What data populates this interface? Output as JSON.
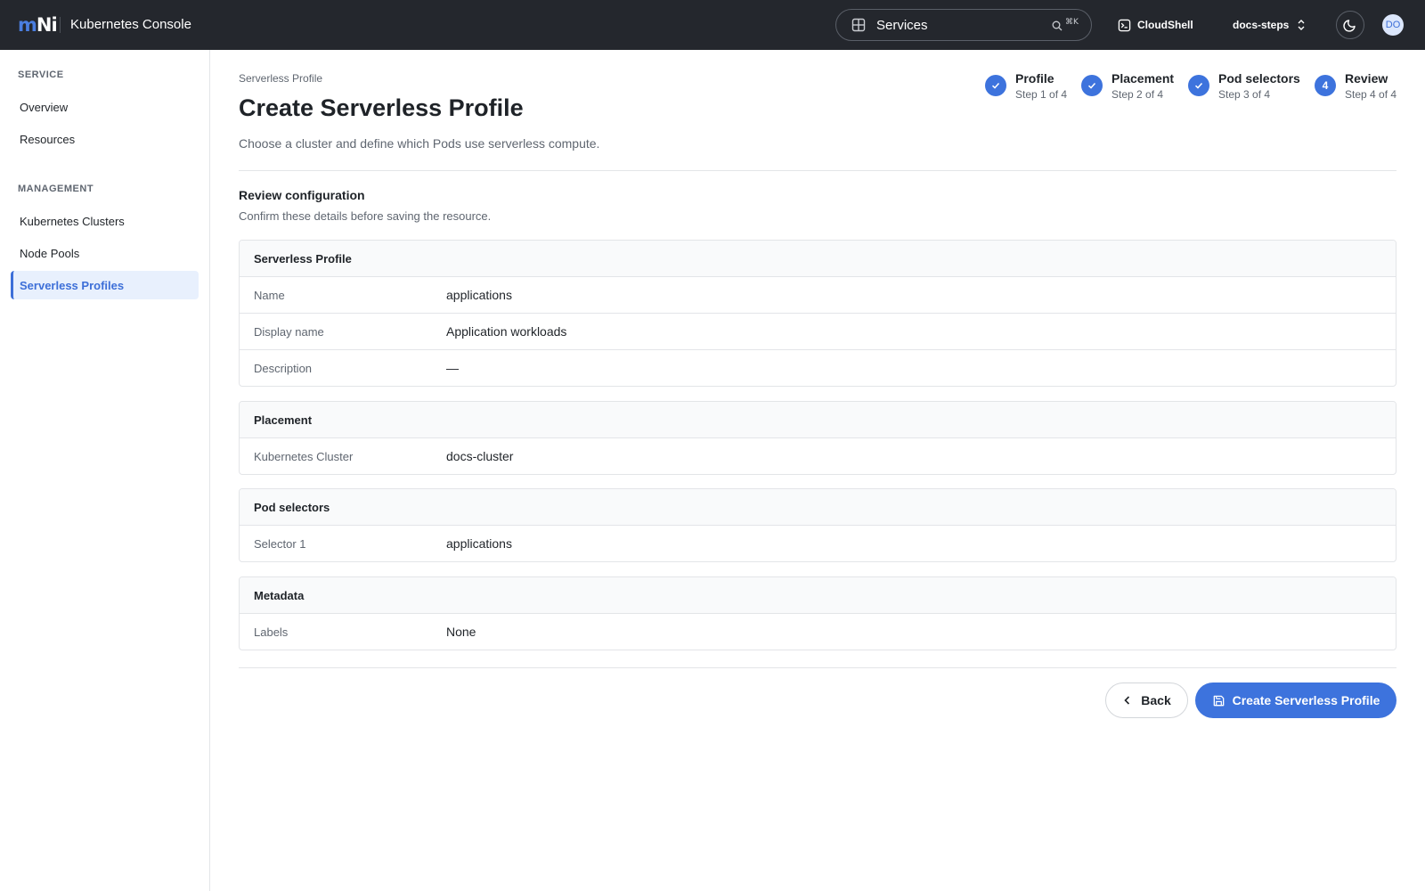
{
  "topbar": {
    "logo_m": "m",
    "logo_ni": "Ni",
    "app_title": "Kubernetes Console",
    "search_value": "Services",
    "search_shortcut": "⌘K",
    "cloudshell_label": "CloudShell",
    "project_label": "docs-steps",
    "avatar_initials": "DO"
  },
  "sidebar": {
    "sections": [
      {
        "title": "SERVICE",
        "items": [
          {
            "label": "Overview"
          },
          {
            "label": "Resources"
          }
        ]
      },
      {
        "title": "MANAGEMENT",
        "items": [
          {
            "label": "Kubernetes Clusters"
          },
          {
            "label": "Node Pools"
          },
          {
            "label": "Serverless Profiles",
            "active": true
          }
        ]
      }
    ]
  },
  "page": {
    "breadcrumb": "Serverless Profile",
    "title": "Create Serverless Profile",
    "description": "Choose a cluster and define which Pods use serverless compute."
  },
  "stepper": {
    "steps": [
      {
        "label": "Profile",
        "sub": "Step 1 of 4",
        "state": "complete"
      },
      {
        "label": "Placement",
        "sub": "Step 2 of 4",
        "state": "complete"
      },
      {
        "label": "Pod selectors",
        "sub": "Step 3 of 4",
        "state": "complete"
      },
      {
        "label": "Review",
        "sub": "Step 4 of 4",
        "state": "current",
        "number": "4"
      }
    ]
  },
  "review": {
    "title": "Review configuration",
    "description": "Confirm these details before saving the resource.",
    "cards": [
      {
        "title": "Serverless Profile",
        "rows": [
          {
            "key": "Name",
            "value": "applications"
          },
          {
            "key": "Display name",
            "value": "Application workloads"
          },
          {
            "key": "Description",
            "value": "—"
          }
        ]
      },
      {
        "title": "Placement",
        "rows": [
          {
            "key": "Kubernetes Cluster",
            "value": "docs-cluster"
          }
        ]
      },
      {
        "title": "Pod selectors",
        "rows": [
          {
            "key": "Selector 1",
            "value": "applications"
          }
        ]
      },
      {
        "title": "Metadata",
        "rows": [
          {
            "key": "Labels",
            "value": "None"
          }
        ]
      }
    ]
  },
  "actions": {
    "back_label": "Back",
    "create_label": "Create Serverless Profile"
  },
  "colors": {
    "topbar_bg": "#24272d",
    "accent": "#3d73dd",
    "active_nav_bg": "#e8f0fd"
  }
}
